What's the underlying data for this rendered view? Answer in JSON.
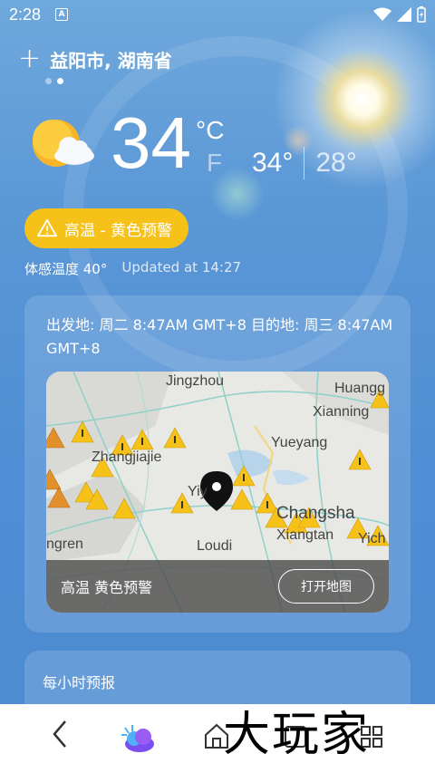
{
  "status_bar": {
    "time": "2:28",
    "notification_icon": "a-icon",
    "icons": [
      "wifi-icon",
      "signal-icon",
      "battery-icon"
    ]
  },
  "header": {
    "location": "益阳市, 湖南省",
    "pages": 2,
    "active_page": 2
  },
  "current": {
    "temperature": "34",
    "unit_c": "°C",
    "unit_f": "F",
    "high": "34°",
    "low": "28°",
    "condition_icon": "sun-cloud-icon"
  },
  "alert": {
    "label": "高温 - 黄色预警",
    "color": "#f6c21a"
  },
  "feels_like": "体感温度 40°",
  "updated": "Updated at 14:27",
  "alert_card": {
    "text": "出发地: 周二 8:47AM GMT+8 目的地: 周三 8:47AM GMT+8",
    "map_labels": [
      "Jingzhou",
      "Huangg",
      "Xianning",
      "Zhangjiajie",
      "Yueyang",
      "Yiy",
      "Changsha",
      "Xiangtan",
      "Yich",
      "ngren",
      "Loudi"
    ],
    "map_alert": "高温 黄色预警",
    "open_map_button": "打开地图"
  },
  "hourly": {
    "title": "每小时预报"
  },
  "nav": {
    "icons": [
      "back-icon",
      "app-weather-icon",
      "home-icon",
      "recents-icon",
      "grid-icon"
    ]
  },
  "watermark": "大玩家"
}
